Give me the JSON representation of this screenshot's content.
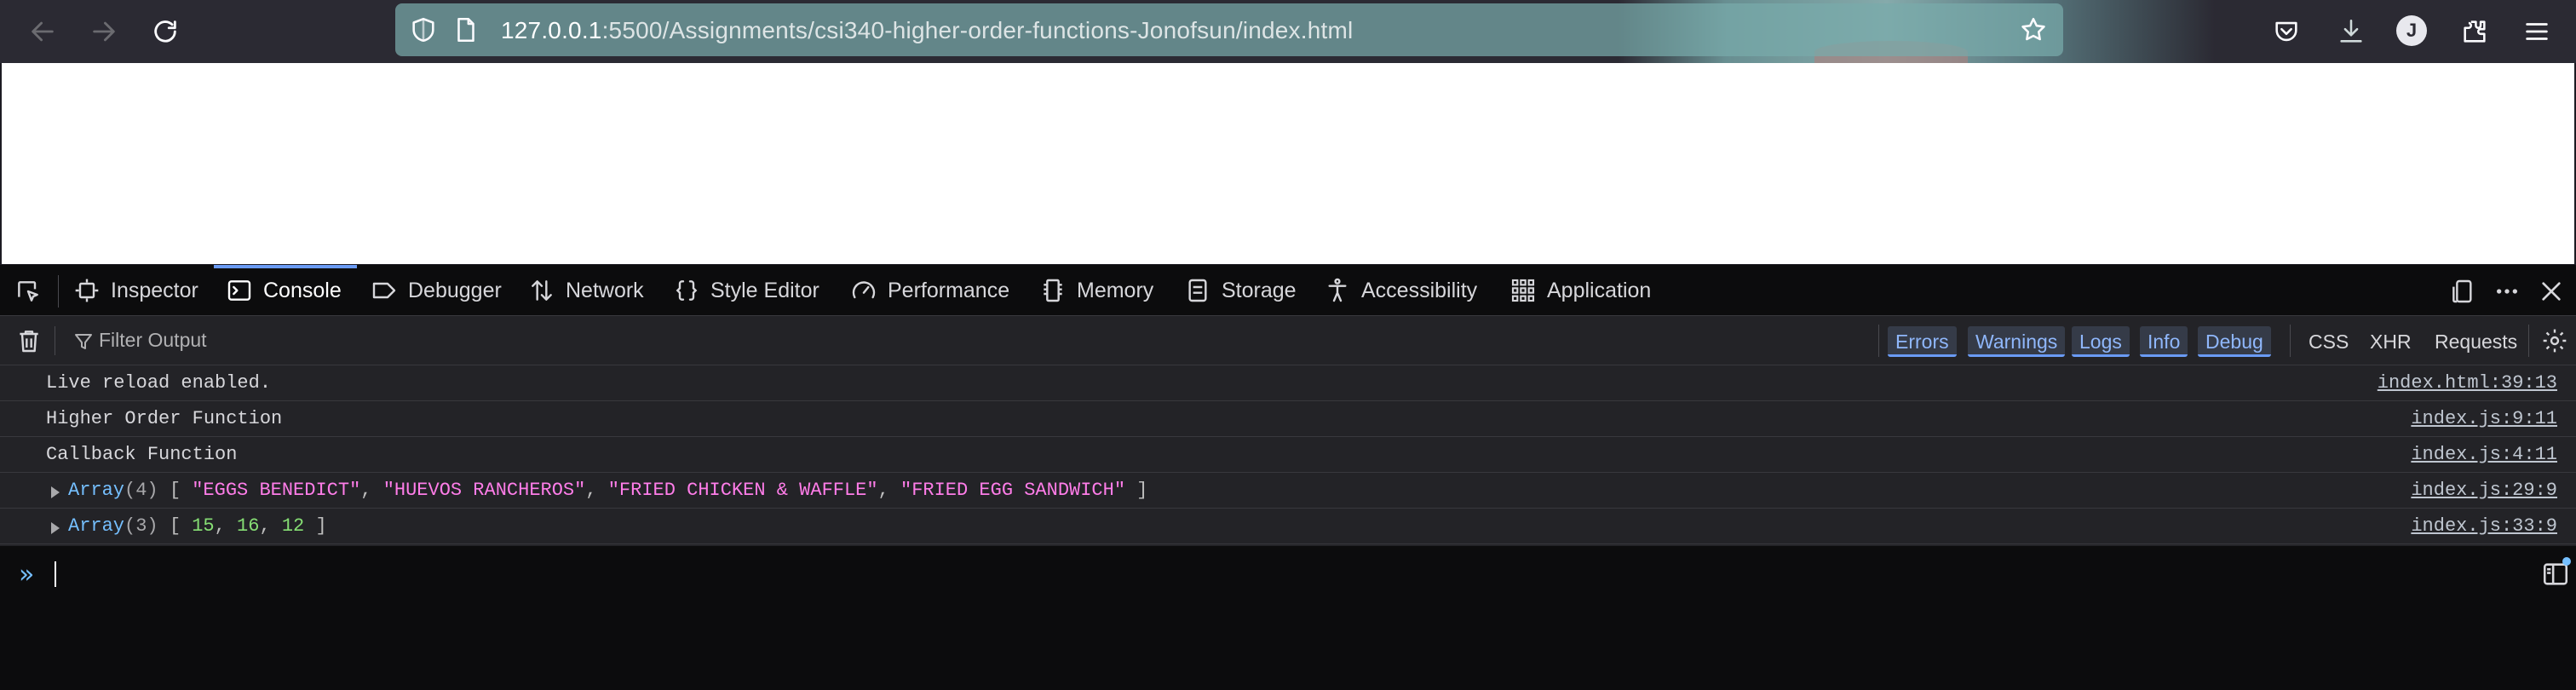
{
  "browser": {
    "url_host": "127.0.0.1",
    "url_path": ":5500/Assignments/csi340-higher-order-functions-Jonofsun/index.html",
    "profile_initial": "J",
    "icons": {
      "back": "back-arrow-icon",
      "forward": "forward-arrow-icon",
      "reload": "reload-icon",
      "shield": "tracking-protection-shield-icon",
      "page": "page-info-icon",
      "bookmark": "bookmark-star-icon",
      "pocket": "pocket-icon",
      "downloads": "downloads-icon",
      "extensions": "extensions-icon",
      "menu": "hamburger-menu-icon"
    }
  },
  "devtools": {
    "tabs": [
      {
        "label": "Inspector",
        "icon": "inspector-icon"
      },
      {
        "label": "Console",
        "icon": "console-icon"
      },
      {
        "label": "Debugger",
        "icon": "debugger-icon"
      },
      {
        "label": "Network",
        "icon": "network-arrows-icon"
      },
      {
        "label": "Style Editor",
        "icon": "braces-icon"
      },
      {
        "label": "Performance",
        "icon": "gauge-icon"
      },
      {
        "label": "Memory",
        "icon": "memory-chip-icon"
      },
      {
        "label": "Storage",
        "icon": "storage-icon"
      },
      {
        "label": "Accessibility",
        "icon": "accessibility-person-icon"
      },
      {
        "label": "Application",
        "icon": "grid-apps-icon"
      }
    ],
    "selected_tab": "Console",
    "filter": {
      "placeholder": "Filter Output",
      "levels": [
        "Errors",
        "Warnings",
        "Logs",
        "Info",
        "Debug"
      ],
      "network_filters": [
        "CSS",
        "XHR",
        "Requests"
      ]
    },
    "messages": [
      {
        "text": "Live reload enabled.",
        "source": "index.html:39:13"
      },
      {
        "text": "Higher Order Function",
        "source": "index.js:9:11"
      },
      {
        "text": "Callback Function",
        "source": "index.js:4:11"
      },
      {
        "kind": "Array",
        "length": "(4)",
        "items": [
          "\"EGGS BENEDICT\"",
          "\"HUEVOS RANCHEROS\"",
          "\"FRIED CHICKEN & WAFFLE\"",
          "\"FRIED EGG SANDWICH\""
        ],
        "source": "index.js:29:9"
      },
      {
        "kind": "Array",
        "length": "(3)",
        "items": [
          "15",
          "16",
          "12"
        ],
        "source": "index.js:33:9"
      }
    ],
    "input_prompt": "»",
    "colors": {
      "accent": "#6a9bf5",
      "string": "#ff7de9",
      "number": "#86de74",
      "keyword": "#75bfff"
    }
  }
}
